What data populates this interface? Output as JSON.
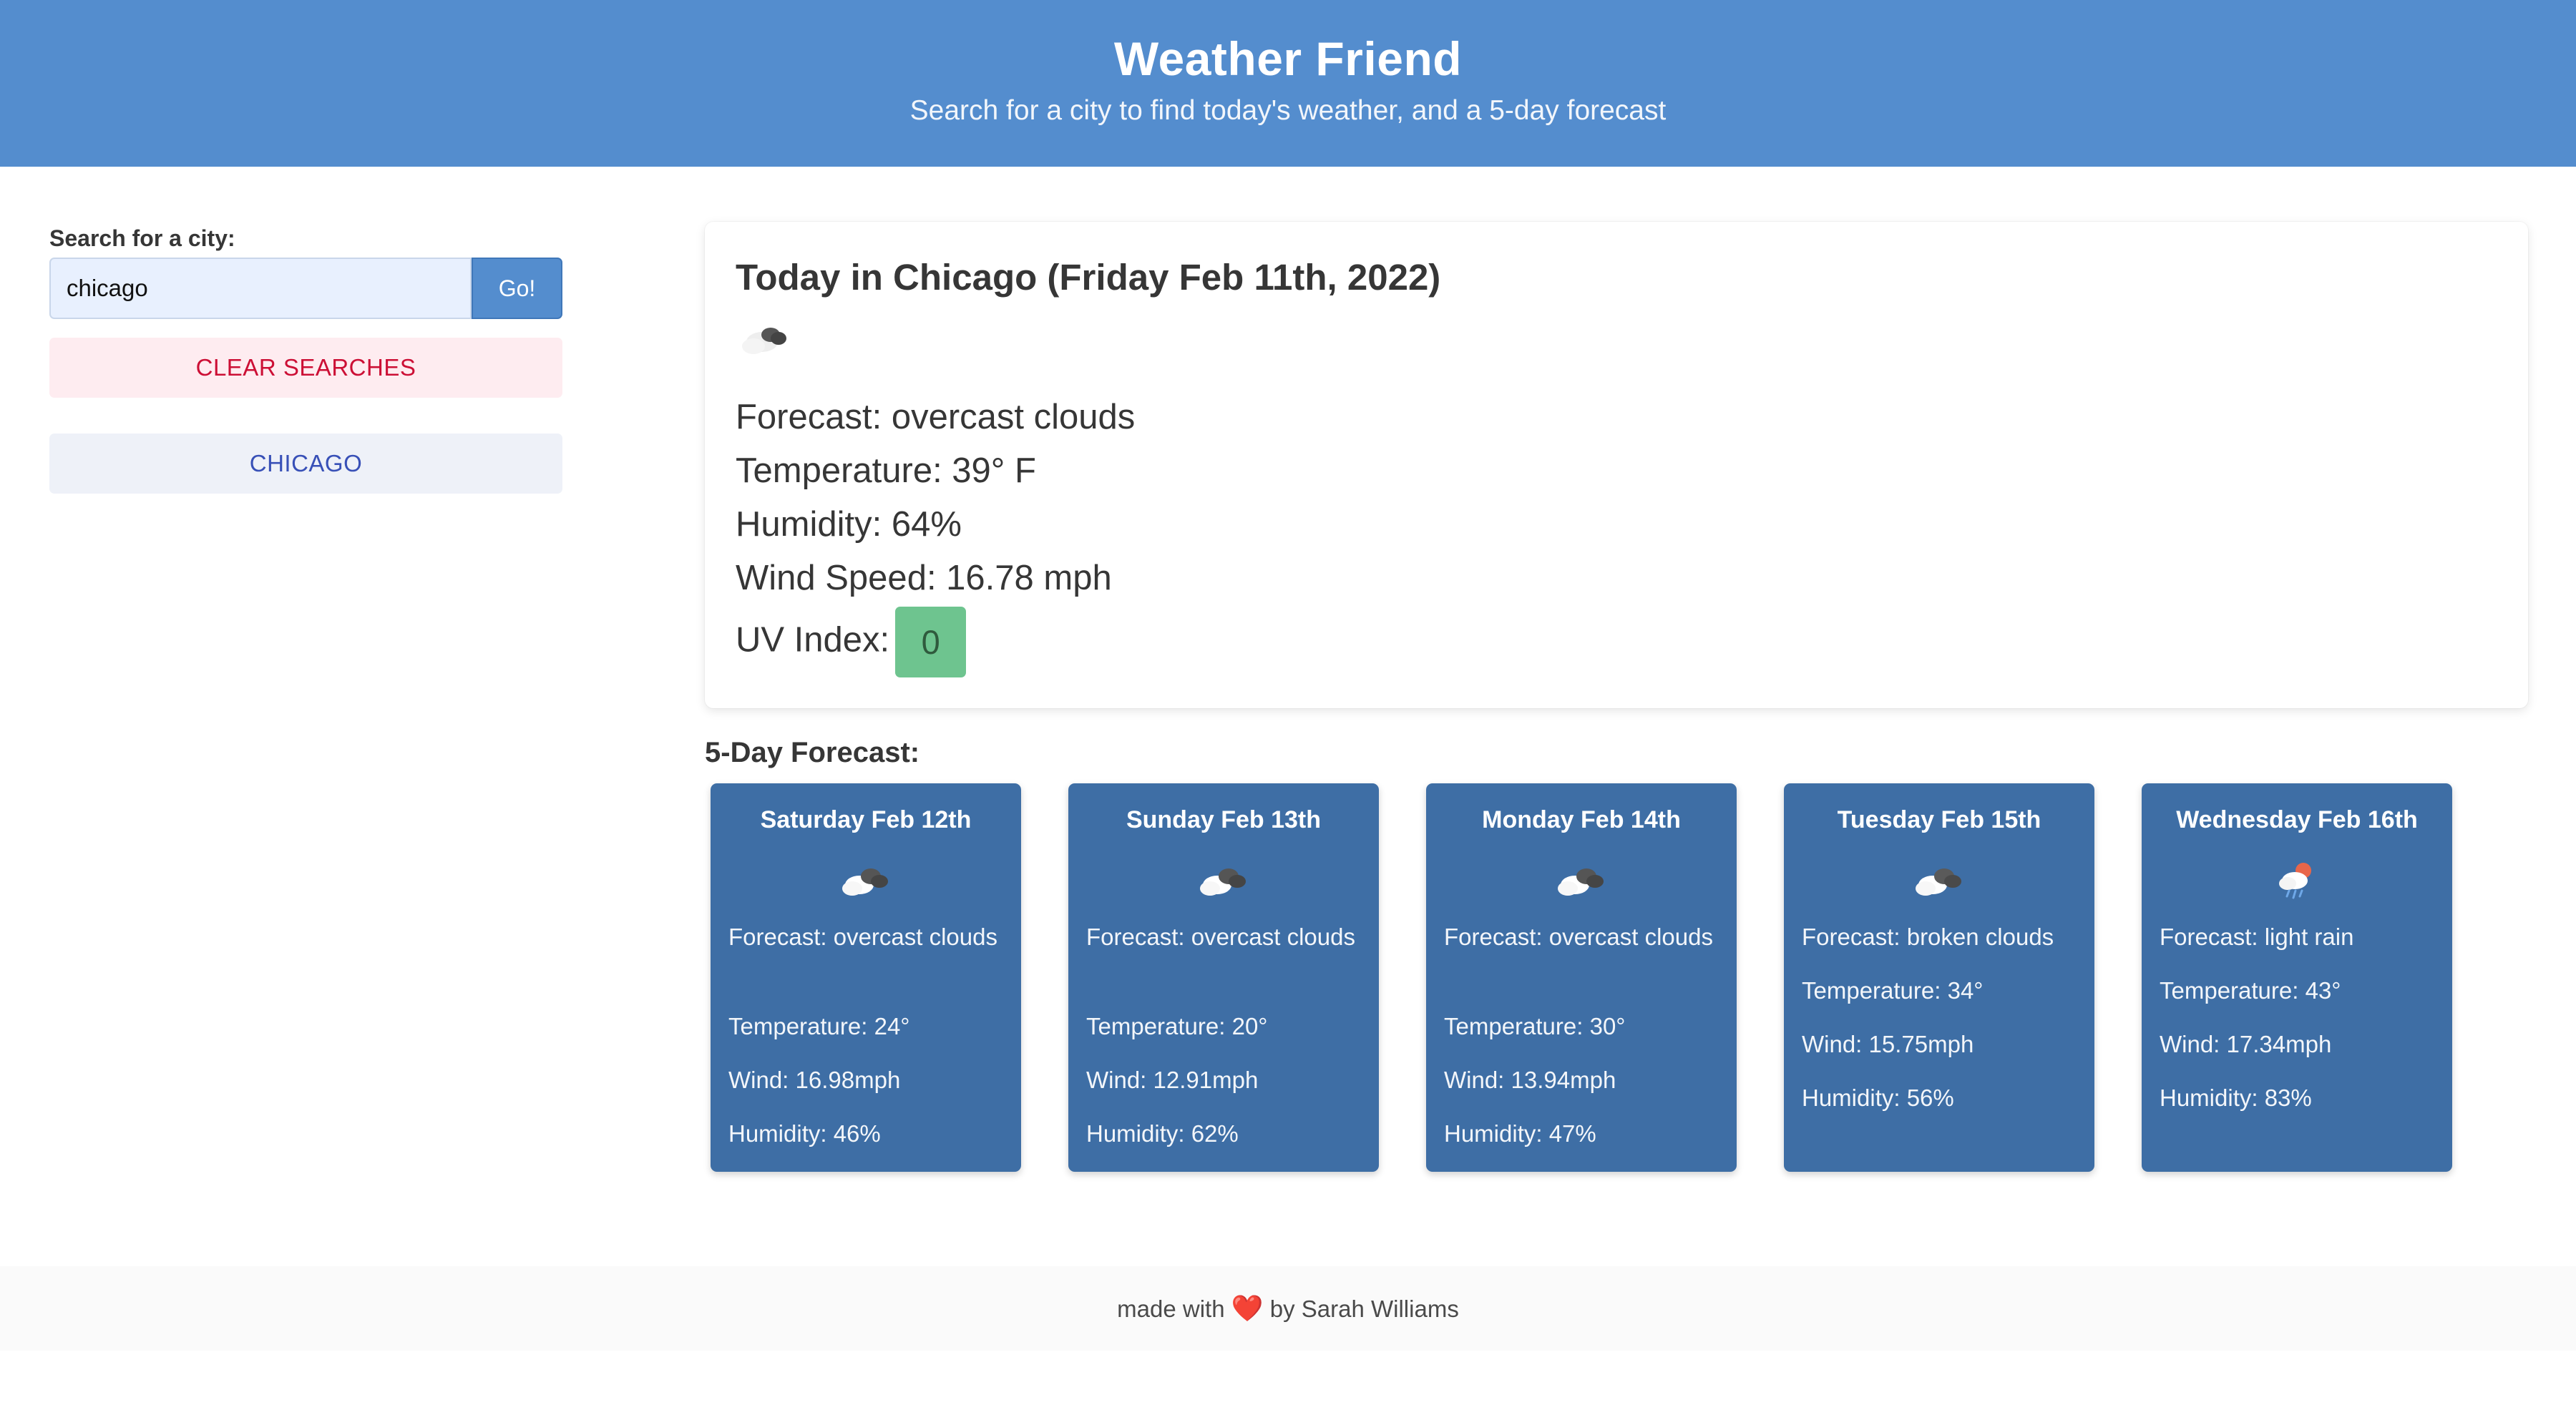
{
  "header": {
    "title": "Weather Friend",
    "subtitle": "Search for a city to find today's weather, and a 5-day forecast"
  },
  "sidebar": {
    "search_label": "Search for a city:",
    "search_value": "chicago",
    "go_label": "Go!",
    "clear_label": "CLEAR SEARCHES",
    "history": [
      "CHICAGO"
    ]
  },
  "today": {
    "title": "Today in Chicago (Friday Feb 11th, 2022)",
    "icon": "overcast-clouds-icon",
    "forecast": "Forecast: overcast clouds",
    "temperature": "Temperature: 39° F",
    "humidity": "Humidity: 64%",
    "wind": "Wind Speed: 16.78 mph",
    "uv_label": "UV Index:",
    "uv_value": "0",
    "uv_color": "#6ec48f"
  },
  "forecast": {
    "heading": "5-Day Forecast:",
    "days": [
      {
        "day": "Saturday Feb 12th",
        "icon": "overcast-clouds-icon",
        "forecast": "Forecast: overcast clouds",
        "temperature": "Temperature: 24°",
        "wind": "Wind: 16.98mph",
        "humidity": "Humidity: 46%"
      },
      {
        "day": "Sunday Feb 13th",
        "icon": "overcast-clouds-icon",
        "forecast": "Forecast: overcast clouds",
        "temperature": "Temperature: 20°",
        "wind": "Wind: 12.91mph",
        "humidity": "Humidity: 62%"
      },
      {
        "day": "Monday Feb 14th",
        "icon": "overcast-clouds-icon",
        "forecast": "Forecast: overcast clouds",
        "temperature": "Temperature: 30°",
        "wind": "Wind: 13.94mph",
        "humidity": "Humidity: 47%"
      },
      {
        "day": "Tuesday Feb 15th",
        "icon": "broken-clouds-icon",
        "forecast": "Forecast: broken clouds",
        "temperature": "Temperature: 34°",
        "wind": "Wind: 15.75mph",
        "humidity": "Humidity: 56%"
      },
      {
        "day": "Wednesday Feb 16th",
        "icon": "light-rain-icon",
        "forecast": "Forecast: light rain",
        "temperature": "Temperature: 43°",
        "wind": "Wind: 17.34mph",
        "humidity": "Humidity: 83%"
      }
    ]
  },
  "footer": {
    "prefix": "made with",
    "heart": "❤️",
    "suffix": "by Sarah Williams"
  },
  "colors": {
    "header_bg": "#548dce",
    "card_bg": "#3e6ea5",
    "clear_bg": "#feecf0",
    "clear_text": "#cc0f35",
    "history_bg": "#eef1f8",
    "history_text": "#3850b7"
  }
}
